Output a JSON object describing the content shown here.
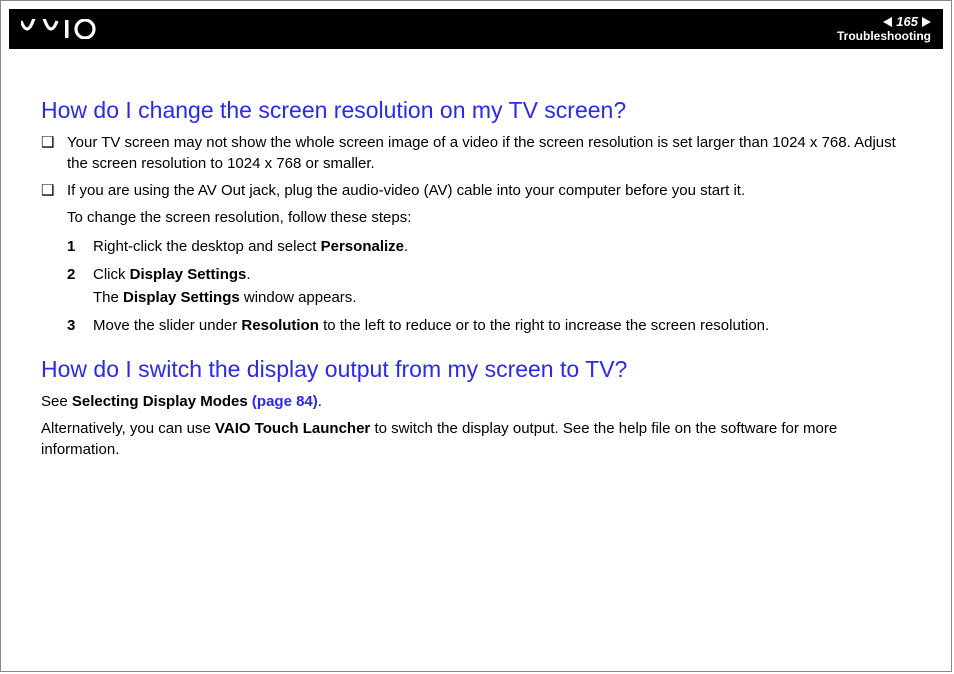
{
  "header": {
    "page_number": "165",
    "section": "Troubleshooting"
  },
  "h1": "How do I change the screen resolution on my TV screen?",
  "b1": "Your TV screen may not show the whole screen image of a video if the screen resolution is set larger than 1024 x 768. Adjust the screen resolution to 1024 x 768 or smaller.",
  "b2": "If you are using the AV Out jack, plug the audio-video (AV) cable into your computer before you start it.",
  "b2_follow": "To change the screen resolution, follow these steps:",
  "steps": {
    "s1_pre": "Right-click the desktop and select ",
    "s1_bold": "Personalize",
    "s1_post": ".",
    "s2_a_pre": "Click ",
    "s2_a_bold": "Display Settings",
    "s2_a_post": ".",
    "s2_b_pre": "The ",
    "s2_b_bold": "Display Settings",
    "s2_b_post": " window appears.",
    "s3_pre": "Move the slider under ",
    "s3_bold": "Resolution",
    "s3_post": " to the left to reduce or to the right to increase the screen resolution."
  },
  "h2": "How do I switch the display output from my screen to TV?",
  "p1_pre": "See ",
  "p1_bold": "Selecting Display Modes ",
  "p1_link": "(page 84)",
  "p1_post": ".",
  "p2_pre": "Alternatively, you can use ",
  "p2_bold": "VAIO Touch Launcher",
  "p2_post": " to switch the display output. See the help file on the software for more information.",
  "nums": {
    "n1": "1",
    "n2": "2",
    "n3": "3"
  },
  "bullet_glyph": "❑"
}
